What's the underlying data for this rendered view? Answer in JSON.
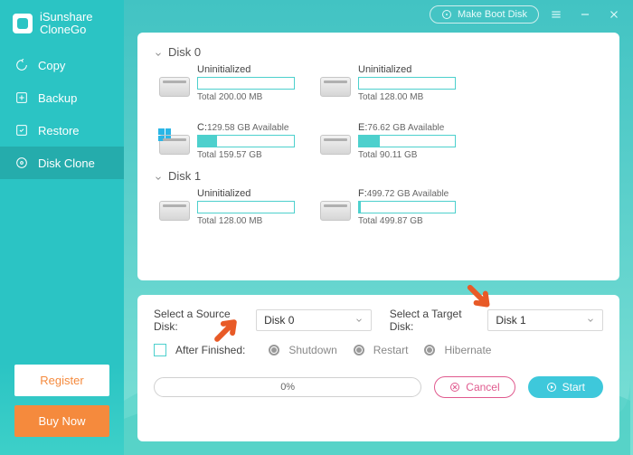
{
  "brand": {
    "line1": "iSunshare",
    "line2": "CloneGo"
  },
  "nav": {
    "items": [
      {
        "label": "Copy"
      },
      {
        "label": "Backup"
      },
      {
        "label": "Restore"
      },
      {
        "label": "Disk Clone"
      }
    ],
    "register": "Register",
    "buy": "Buy Now"
  },
  "titlebar": {
    "makeBoot": "Make Boot Disk"
  },
  "disks": [
    {
      "name": "Disk 0",
      "parts": [
        {
          "label": "Uninitialized",
          "avail": "",
          "total": "Total 200.00 MB",
          "fill": 0,
          "win": false
        },
        {
          "label": "Uninitialized",
          "avail": "",
          "total": "Total 128.00 MB",
          "fill": 0,
          "win": false
        },
        {
          "label": "C:",
          "avail": "129.58 GB Available",
          "total": "Total 159.57 GB",
          "fill": 20,
          "win": true
        },
        {
          "label": "E:",
          "avail": "76.62 GB Available",
          "total": "Total 90.11 GB",
          "fill": 22,
          "win": false
        }
      ]
    },
    {
      "name": "Disk 1",
      "parts": [
        {
          "label": "Uninitialized",
          "avail": "",
          "total": "Total 128.00 MB",
          "fill": 0,
          "win": false
        },
        {
          "label": "F:",
          "avail": "499.72 GB Available",
          "total": "Total 499.87 GB",
          "fill": 2,
          "win": false
        }
      ]
    }
  ],
  "opts": {
    "srcLabel": "Select a Source Disk:",
    "srcValue": "Disk 0",
    "tgtLabel": "Select a Target Disk:",
    "tgtValue": "Disk 1",
    "afterLabel": "After Finished:",
    "r1": "Shutdown",
    "r2": "Restart",
    "r3": "Hibernate",
    "progress": "0%",
    "cancel": "Cancel",
    "start": "Start"
  }
}
